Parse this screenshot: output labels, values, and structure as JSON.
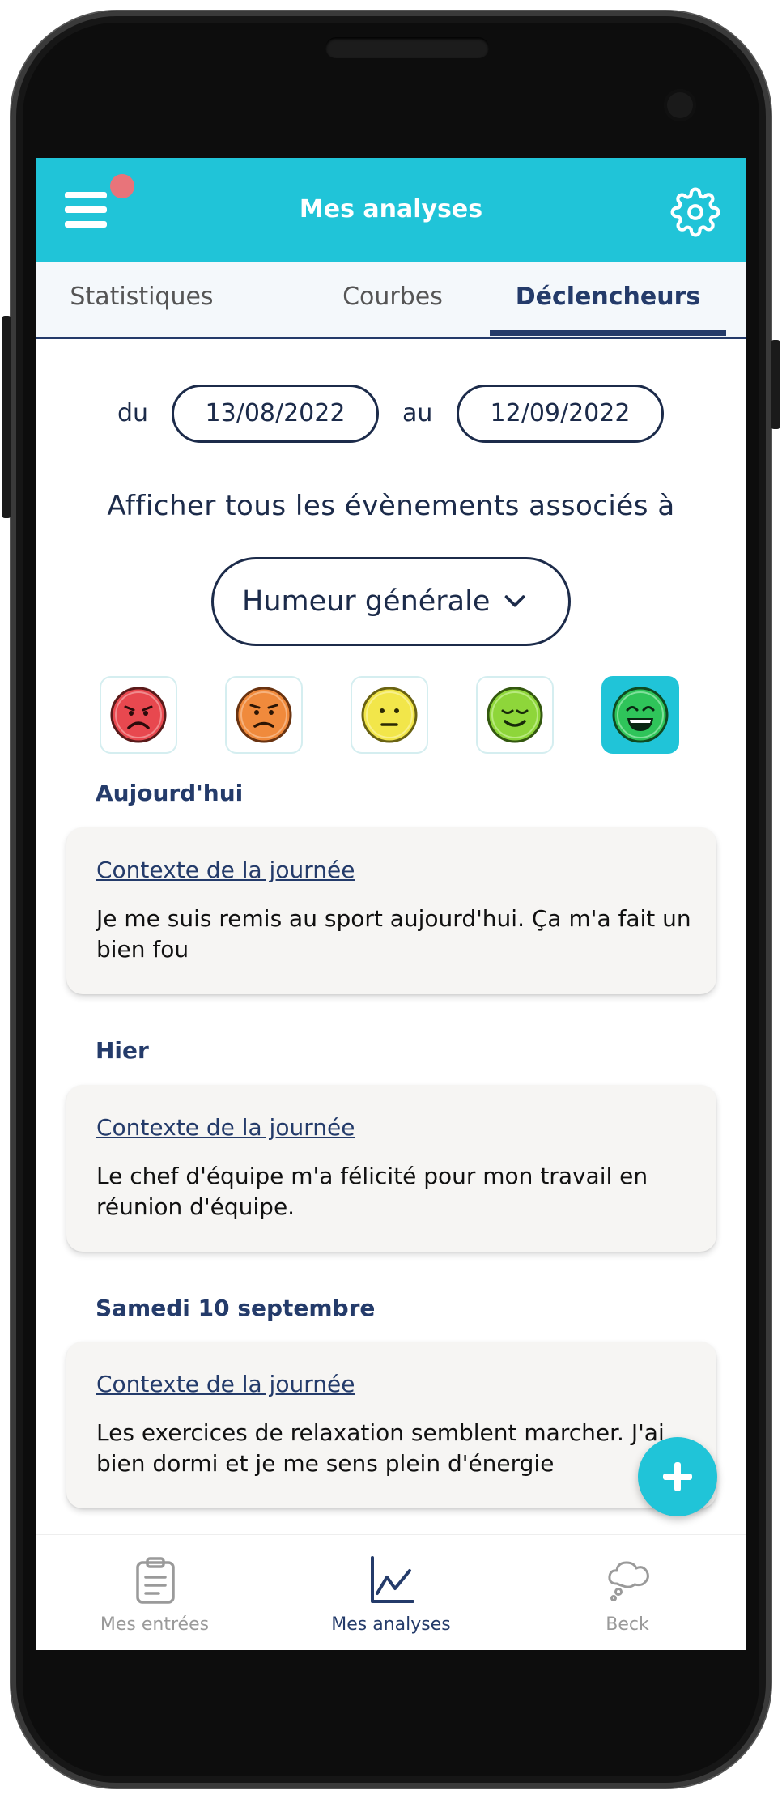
{
  "header": {
    "title": "Mes analyses"
  },
  "tabs": [
    {
      "label": "Statistiques",
      "active": false
    },
    {
      "label": "Courbes",
      "active": false
    },
    {
      "label": "Déclencheurs",
      "active": true
    }
  ],
  "filters": {
    "from_label": "du",
    "from_date": "13/08/2022",
    "to_label": "au",
    "to_date": "12/09/2022",
    "subtitle": "Afficher tous les évènements associés à",
    "category": "Humeur générale"
  },
  "moods": [
    {
      "name": "very-sad",
      "color": "#e8484f",
      "selected": false
    },
    {
      "name": "sad",
      "color": "#f08a3c",
      "selected": false
    },
    {
      "name": "neutral",
      "color": "#f2e64a",
      "selected": false
    },
    {
      "name": "content",
      "color": "#8ed63a",
      "selected": false
    },
    {
      "name": "very-happy",
      "color": "#2fc45a",
      "selected": true
    }
  ],
  "entries": [
    {
      "day": "Aujourd'hui",
      "link": "Contexte de la journée",
      "text": "Je me suis remis au sport aujourd'hui. Ça m'a fait un bien fou"
    },
    {
      "day": "Hier",
      "link": "Contexte de la journée",
      "text": "Le chef d'équipe m'a félicité pour mon travail en réunion d'équipe."
    },
    {
      "day": "Samedi 10 septembre",
      "link": "Contexte de la journée",
      "text": "Les exercices de relaxation semblent marcher. J'ai bien dormi et je me sens plein d'énergie"
    }
  ],
  "bottom_nav": [
    {
      "label": "Mes entrées",
      "icon": "clipboard-icon",
      "active": false
    },
    {
      "label": "Mes analyses",
      "icon": "chart-icon",
      "active": true
    },
    {
      "label": "Beck",
      "icon": "thought-cloud-icon",
      "active": false
    }
  ],
  "colors": {
    "accent": "#20c4d8",
    "navy": "#243b6a",
    "notification": "#e8747a"
  }
}
